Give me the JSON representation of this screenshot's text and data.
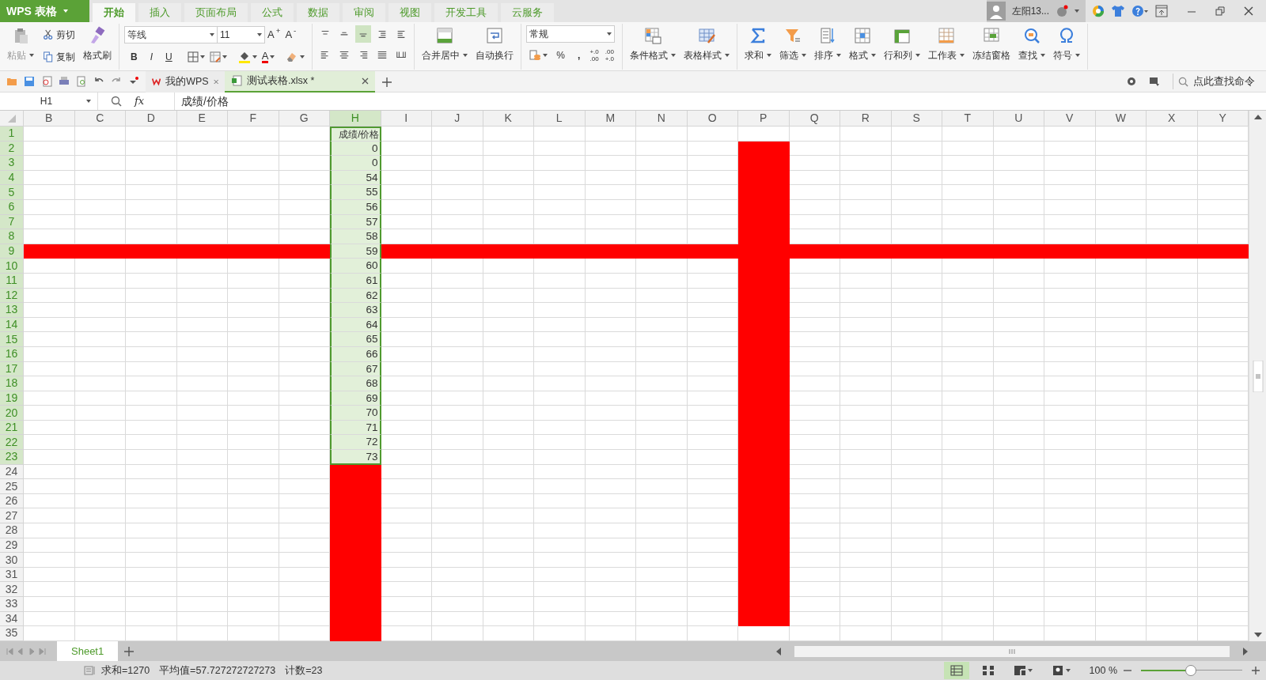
{
  "app_button": {
    "label": "WPS 表格"
  },
  "menu_tabs": [
    {
      "label": "开始",
      "selected": true
    },
    {
      "label": "插入",
      "selected": false
    },
    {
      "label": "页面布局",
      "selected": false
    },
    {
      "label": "公式",
      "selected": false
    },
    {
      "label": "数据",
      "selected": false
    },
    {
      "label": "审阅",
      "selected": false
    },
    {
      "label": "视图",
      "selected": false
    },
    {
      "label": "开发工具",
      "selected": false
    },
    {
      "label": "云服务",
      "selected": false
    }
  ],
  "account": {
    "name": "左阳13..."
  },
  "ribbon_groups": [
    {
      "kind": "clipboard",
      "paste": {
        "label": "粘贴",
        "disabled": true
      },
      "cut": "剪切",
      "copy": "复制",
      "painter": "格式刷"
    },
    {
      "kind": "font",
      "font": "等线",
      "size": "11",
      "size_buttons": [
        "A$^{+}$",
        "A$^{-}$"
      ],
      "style_buttons": [
        "B",
        "I",
        "U"
      ],
      "font_color": "A"
    },
    {
      "kind": "alignment",
      "buttons": [
        {
          "selected": false
        },
        {
          "selected": false
        },
        {
          "selected": true
        },
        {
          "selected": false
        },
        {
          "selected": false
        },
        {
          "selected": false
        },
        {
          "selected": false
        },
        {
          "selected": false
        },
        {
          "selected": false
        },
        {
          "selected": false
        }
      ]
    },
    {
      "kind": "buttons",
      "buttons": [
        {
          "label": "合并居中",
          "dropdown": true
        },
        {
          "label": "自动换行",
          "dropdown": false
        }
      ]
    },
    {
      "kind": "number",
      "format": "常规",
      "percent": "%",
      "comma": ",",
      "decimal_buttons": [
        [
          "+.0",
          ".00"
        ],
        [
          ".00",
          "+.0"
        ]
      ]
    },
    {
      "kind": "buttons",
      "buttons": [
        {
          "label": "条件格式",
          "dropdown": true
        },
        {
          "label": "表格样式",
          "dropdown": true
        }
      ]
    },
    {
      "kind": "buttons",
      "buttons": [
        {
          "label": "求和",
          "dropdown": true
        },
        {
          "label": "筛选",
          "dropdown": true
        },
        {
          "label": "排序",
          "dropdown": true
        },
        {
          "label": "格式",
          "dropdown": true
        },
        {
          "label": "行和列",
          "dropdown": true
        },
        {
          "label": "工作表",
          "dropdown": true
        },
        {
          "label": "冻结窗格",
          "dropdown": false
        },
        {
          "label": "查找",
          "dropdown": true
        },
        {
          "label": "符号",
          "dropdown": true
        }
      ]
    }
  ],
  "document_tabs": [
    {
      "label": "我的WPS",
      "selected": false
    },
    {
      "label": "测试表格.xlsx *",
      "selected": true
    }
  ],
  "command_search": {
    "placeholder": "点此查找命令"
  },
  "formula_bar": {
    "name_box": "H1",
    "fx": "fx",
    "value": "成绩/价格"
  },
  "grid": {
    "color": "#ff0000",
    "columns": [
      {
        "label": "B",
        "selected": false,
        "kind": "empty"
      },
      {
        "label": "C",
        "selected": false,
        "kind": "empty"
      },
      {
        "label": "D",
        "selected": false,
        "kind": "empty"
      },
      {
        "label": "E",
        "selected": false,
        "kind": "empty"
      },
      {
        "label": "F",
        "selected": false,
        "kind": "empty"
      },
      {
        "label": "G",
        "selected": false,
        "kind": "empty"
      },
      {
        "label": "H",
        "selected": true,
        "kind": "data"
      },
      {
        "label": "I",
        "selected": false,
        "kind": "empty"
      },
      {
        "label": "J",
        "selected": false,
        "kind": "empty"
      },
      {
        "label": "K",
        "selected": false,
        "kind": "empty"
      },
      {
        "label": "L",
        "selected": false,
        "kind": "empty"
      },
      {
        "label": "M",
        "selected": false,
        "kind": "empty"
      },
      {
        "label": "N",
        "selected": false,
        "kind": "empty"
      },
      {
        "label": "O",
        "selected": false,
        "kind": "empty"
      },
      {
        "label": "P",
        "selected": false,
        "kind": "empty"
      },
      {
        "label": "Q",
        "selected": false,
        "kind": "empty"
      },
      {
        "label": "R",
        "selected": false,
        "kind": "empty"
      },
      {
        "label": "S",
        "selected": false,
        "kind": "empty"
      },
      {
        "label": "T",
        "selected": false,
        "kind": "empty"
      },
      {
        "label": "U",
        "selected": false,
        "kind": "empty"
      },
      {
        "label": "V",
        "selected": false,
        "kind": "empty"
      },
      {
        "label": "W",
        "selected": false,
        "kind": "empty"
      },
      {
        "label": "X",
        "selected": false,
        "kind": "empty"
      },
      {
        "label": "Y",
        "selected": false,
        "kind": "empty"
      }
    ],
    "rows": [
      {
        "label": "1",
        "selected": true,
        "value": "成绩/价格",
        "filled": [
          false,
          false,
          false,
          false,
          false,
          false,
          false,
          false,
          false,
          false,
          false,
          false,
          false,
          false,
          false,
          false,
          false,
          false,
          false,
          false,
          false,
          false,
          false,
          false
        ]
      },
      {
        "label": "2",
        "selected": true,
        "value": "0",
        "filled": [
          false,
          false,
          false,
          false,
          false,
          false,
          false,
          false,
          false,
          false,
          false,
          false,
          false,
          false,
          true,
          false,
          false,
          false,
          false,
          false,
          false,
          false,
          false,
          false
        ]
      },
      {
        "label": "3",
        "selected": true,
        "value": "0",
        "filled": [
          false,
          false,
          false,
          false,
          false,
          false,
          false,
          false,
          false,
          false,
          false,
          false,
          false,
          false,
          true,
          false,
          false,
          false,
          false,
          false,
          false,
          false,
          false,
          false
        ]
      },
      {
        "label": "4",
        "selected": true,
        "value": "54",
        "filled": [
          false,
          false,
          false,
          false,
          false,
          false,
          false,
          false,
          false,
          false,
          false,
          false,
          false,
          false,
          true,
          false,
          false,
          false,
          false,
          false,
          false,
          false,
          false,
          false
        ]
      },
      {
        "label": "5",
        "selected": true,
        "value": "55",
        "filled": [
          false,
          false,
          false,
          false,
          false,
          false,
          false,
          false,
          false,
          false,
          false,
          false,
          false,
          false,
          true,
          false,
          false,
          false,
          false,
          false,
          false,
          false,
          false,
          false
        ]
      },
      {
        "label": "6",
        "selected": true,
        "value": "56",
        "filled": [
          false,
          false,
          false,
          false,
          false,
          false,
          false,
          false,
          false,
          false,
          false,
          false,
          false,
          false,
          true,
          false,
          false,
          false,
          false,
          false,
          false,
          false,
          false,
          false
        ]
      },
      {
        "label": "7",
        "selected": true,
        "value": "57",
        "filled": [
          false,
          false,
          false,
          false,
          false,
          false,
          false,
          false,
          false,
          false,
          false,
          false,
          false,
          false,
          true,
          false,
          false,
          false,
          false,
          false,
          false,
          false,
          false,
          false
        ]
      },
      {
        "label": "8",
        "selected": true,
        "value": "58",
        "filled": [
          false,
          false,
          false,
          false,
          false,
          false,
          false,
          false,
          false,
          false,
          false,
          false,
          false,
          false,
          true,
          false,
          false,
          false,
          false,
          false,
          false,
          false,
          false,
          false
        ]
      },
      {
        "label": "9",
        "selected": true,
        "value": "59",
        "filled": [
          true,
          true,
          true,
          true,
          true,
          true,
          false,
          true,
          true,
          true,
          true,
          true,
          true,
          true,
          true,
          true,
          true,
          true,
          true,
          true,
          true,
          true,
          true,
          true
        ]
      },
      {
        "label": "10",
        "selected": true,
        "value": "60",
        "filled": [
          false,
          false,
          false,
          false,
          false,
          false,
          false,
          false,
          false,
          false,
          false,
          false,
          false,
          false,
          true,
          false,
          false,
          false,
          false,
          false,
          false,
          false,
          false,
          false
        ]
      },
      {
        "label": "11",
        "selected": true,
        "value": "61",
        "filled": [
          false,
          false,
          false,
          false,
          false,
          false,
          false,
          false,
          false,
          false,
          false,
          false,
          false,
          false,
          true,
          false,
          false,
          false,
          false,
          false,
          false,
          false,
          false,
          false
        ]
      },
      {
        "label": "12",
        "selected": true,
        "value": "62",
        "filled": [
          false,
          false,
          false,
          false,
          false,
          false,
          false,
          false,
          false,
          false,
          false,
          false,
          false,
          false,
          true,
          false,
          false,
          false,
          false,
          false,
          false,
          false,
          false,
          false
        ]
      },
      {
        "label": "13",
        "selected": true,
        "value": "63",
        "filled": [
          false,
          false,
          false,
          false,
          false,
          false,
          false,
          false,
          false,
          false,
          false,
          false,
          false,
          false,
          true,
          false,
          false,
          false,
          false,
          false,
          false,
          false,
          false,
          false
        ]
      },
      {
        "label": "14",
        "selected": true,
        "value": "64",
        "filled": [
          false,
          false,
          false,
          false,
          false,
          false,
          false,
          false,
          false,
          false,
          false,
          false,
          false,
          false,
          true,
          false,
          false,
          false,
          false,
          false,
          false,
          false,
          false,
          false
        ]
      },
      {
        "label": "15",
        "selected": true,
        "value": "65",
        "filled": [
          false,
          false,
          false,
          false,
          false,
          false,
          false,
          false,
          false,
          false,
          false,
          false,
          false,
          false,
          true,
          false,
          false,
          false,
          false,
          false,
          false,
          false,
          false,
          false
        ]
      },
      {
        "label": "16",
        "selected": true,
        "value": "66",
        "filled": [
          false,
          false,
          false,
          false,
          false,
          false,
          false,
          false,
          false,
          false,
          false,
          false,
          false,
          false,
          true,
          false,
          false,
          false,
          false,
          false,
          false,
          false,
          false,
          false
        ]
      },
      {
        "label": "17",
        "selected": true,
        "value": "67",
        "filled": [
          false,
          false,
          false,
          false,
          false,
          false,
          false,
          false,
          false,
          false,
          false,
          false,
          false,
          false,
          true,
          false,
          false,
          false,
          false,
          false,
          false,
          false,
          false,
          false
        ]
      },
      {
        "label": "18",
        "selected": true,
        "value": "68",
        "filled": [
          false,
          false,
          false,
          false,
          false,
          false,
          false,
          false,
          false,
          false,
          false,
          false,
          false,
          false,
          true,
          false,
          false,
          false,
          false,
          false,
          false,
          false,
          false,
          false
        ]
      },
      {
        "label": "19",
        "selected": true,
        "value": "69",
        "filled": [
          false,
          false,
          false,
          false,
          false,
          false,
          false,
          false,
          false,
          false,
          false,
          false,
          false,
          false,
          true,
          false,
          false,
          false,
          false,
          false,
          false,
          false,
          false,
          false
        ]
      },
      {
        "label": "20",
        "selected": true,
        "value": "70",
        "filled": [
          false,
          false,
          false,
          false,
          false,
          false,
          false,
          false,
          false,
          false,
          false,
          false,
          false,
          false,
          true,
          false,
          false,
          false,
          false,
          false,
          false,
          false,
          false,
          false
        ]
      },
      {
        "label": "21",
        "selected": true,
        "value": "71",
        "filled": [
          false,
          false,
          false,
          false,
          false,
          false,
          false,
          false,
          false,
          false,
          false,
          false,
          false,
          false,
          true,
          false,
          false,
          false,
          false,
          false,
          false,
          false,
          false,
          false
        ]
      },
      {
        "label": "22",
        "selected": true,
        "value": "72",
        "filled": [
          false,
          false,
          false,
          false,
          false,
          false,
          false,
          false,
          false,
          false,
          false,
          false,
          false,
          false,
          true,
          false,
          false,
          false,
          false,
          false,
          false,
          false,
          false,
          false
        ]
      },
      {
        "label": "23",
        "selected": true,
        "value": "73",
        "filled": [
          false,
          false,
          false,
          false,
          false,
          false,
          false,
          false,
          false,
          false,
          false,
          false,
          false,
          false,
          true,
          false,
          false,
          false,
          false,
          false,
          false,
          false,
          false,
          false
        ]
      },
      {
        "label": "24",
        "selected": false,
        "filled": [
          false,
          false,
          false,
          false,
          false,
          false,
          true,
          false,
          false,
          false,
          false,
          false,
          false,
          false,
          true,
          false,
          false,
          false,
          false,
          false,
          false,
          false,
          false,
          false
        ]
      },
      {
        "label": "25",
        "selected": false,
        "filled": [
          false,
          false,
          false,
          false,
          false,
          false,
          true,
          false,
          false,
          false,
          false,
          false,
          false,
          false,
          true,
          false,
          false,
          false,
          false,
          false,
          false,
          false,
          false,
          false
        ]
      },
      {
        "label": "26",
        "selected": false,
        "filled": [
          false,
          false,
          false,
          false,
          false,
          false,
          true,
          false,
          false,
          false,
          false,
          false,
          false,
          false,
          true,
          false,
          false,
          false,
          false,
          false,
          false,
          false,
          false,
          false
        ]
      },
      {
        "label": "27",
        "selected": false,
        "filled": [
          false,
          false,
          false,
          false,
          false,
          false,
          true,
          false,
          false,
          false,
          false,
          false,
          false,
          false,
          true,
          false,
          false,
          false,
          false,
          false,
          false,
          false,
          false,
          false
        ]
      },
      {
        "label": "28",
        "selected": false,
        "filled": [
          false,
          false,
          false,
          false,
          false,
          false,
          true,
          false,
          false,
          false,
          false,
          false,
          false,
          false,
          true,
          false,
          false,
          false,
          false,
          false,
          false,
          false,
          false,
          false
        ]
      },
      {
        "label": "29",
        "selected": false,
        "filled": [
          false,
          false,
          false,
          false,
          false,
          false,
          true,
          false,
          false,
          false,
          false,
          false,
          false,
          false,
          true,
          false,
          false,
          false,
          false,
          false,
          false,
          false,
          false,
          false
        ]
      },
      {
        "label": "30",
        "selected": false,
        "filled": [
          false,
          false,
          false,
          false,
          false,
          false,
          true,
          false,
          false,
          false,
          false,
          false,
          false,
          false,
          true,
          false,
          false,
          false,
          false,
          false,
          false,
          false,
          false,
          false
        ]
      },
      {
        "label": "31",
        "selected": false,
        "filled": [
          false,
          false,
          false,
          false,
          false,
          false,
          true,
          false,
          false,
          false,
          false,
          false,
          false,
          false,
          true,
          false,
          false,
          false,
          false,
          false,
          false,
          false,
          false,
          false
        ]
      },
      {
        "label": "32",
        "selected": false,
        "filled": [
          false,
          false,
          false,
          false,
          false,
          false,
          true,
          false,
          false,
          false,
          false,
          false,
          false,
          false,
          true,
          false,
          false,
          false,
          false,
          false,
          false,
          false,
          false,
          false
        ]
      },
      {
        "label": "33",
        "selected": false,
        "filled": [
          false,
          false,
          false,
          false,
          false,
          false,
          true,
          false,
          false,
          false,
          false,
          false,
          false,
          false,
          true,
          false,
          false,
          false,
          false,
          false,
          false,
          false,
          false,
          false
        ]
      },
      {
        "label": "34",
        "selected": false,
        "filled": [
          false,
          false,
          false,
          false,
          false,
          false,
          true,
          false,
          false,
          false,
          false,
          false,
          false,
          false,
          true,
          false,
          false,
          false,
          false,
          false,
          false,
          false,
          false,
          false
        ]
      },
      {
        "label": "35",
        "selected": false,
        "filled": [
          false,
          false,
          false,
          false,
          false,
          false,
          true,
          false,
          false,
          false,
          false,
          false,
          false,
          false,
          false,
          false,
          false,
          false,
          false,
          false,
          false,
          false,
          false,
          false
        ]
      }
    ]
  },
  "sheet_tabs": [
    {
      "label": "Sheet1",
      "selected": true
    }
  ],
  "status_bar": {
    "summary": [
      "求和=1270",
      "平均值=57.727272727273",
      "计数=23"
    ],
    "view_buttons": [
      {
        "selected": true,
        "dropdown": false
      },
      {
        "selected": false,
        "dropdown": false
      },
      {
        "selected": false,
        "dropdown": true
      },
      {
        "selected": false,
        "dropdown": true
      }
    ],
    "zoom": "100 %",
    "zoom_slider": {
      "level": 0.49
    }
  }
}
